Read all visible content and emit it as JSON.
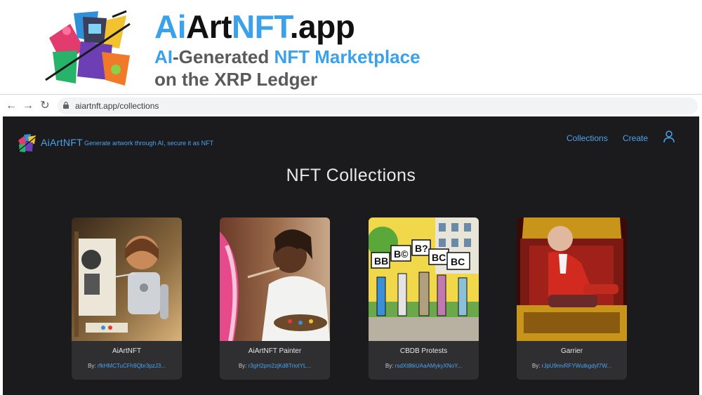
{
  "banner": {
    "title_part1": "Ai",
    "title_part2": "Art",
    "title_part3": "NFT",
    "title_part4": ".app",
    "subtitle1_part1": "AI",
    "subtitle1_part2": "-Generated ",
    "subtitle1_part3": "NFT Marketplace",
    "subtitle2": "on the XRP Ledger",
    "logo_icon": "painting-robot-logo"
  },
  "browser": {
    "back_icon": "←",
    "forward_icon": "→",
    "reload_icon": "↻",
    "url": "aiartnft.app/collections"
  },
  "app": {
    "name": "AiArtNFT",
    "tagline": "Generate artwork through AI, secure it as NFT",
    "nav": {
      "collections": "Collections",
      "create": "Create"
    },
    "page_title": "NFT Collections",
    "colors": {
      "background": "#1b1b1d",
      "card": "#2f2f31",
      "accent": "#4aa3f0"
    }
  },
  "collections": [
    {
      "name": "AiArtNFT",
      "by_label": "By: ",
      "owner": "rfkHMCTuCFh9Qbr3pzJ3...",
      "image": "child-robot-painting"
    },
    {
      "name": "AiArtNFT Painter",
      "by_label": "By: ",
      "owner": "r3gH2pm2zjKd8TriotYL...",
      "image": "artist-painting-canvas"
    },
    {
      "name": "CBDB Protests",
      "by_label": "By: ",
      "owner": "rsdXt8tkUAaAMykyXNoY...",
      "image": "comic-protest-signs"
    },
    {
      "name": "Garrier",
      "by_label": "By: ",
      "owner": "rJpU9mvRFYWutkgdyf7W...",
      "image": "man-on-throne"
    }
  ]
}
